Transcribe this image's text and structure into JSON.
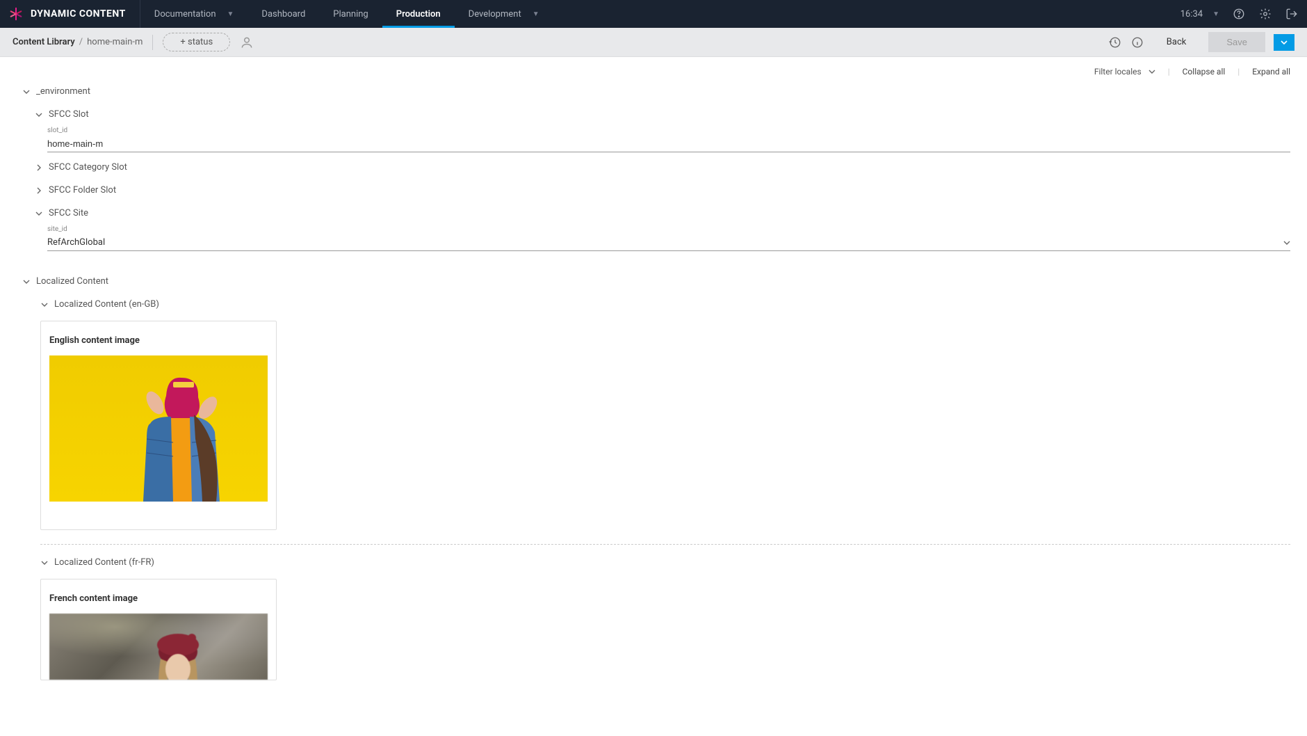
{
  "app": {
    "name": "DYNAMIC CONTENT",
    "time": "16:34"
  },
  "nav": {
    "documentation": "Documentation",
    "dashboard": "Dashboard",
    "planning": "Planning",
    "production": "Production",
    "development": "Development"
  },
  "subbar": {
    "crumb_root": "Content Library",
    "crumb_item": "home-main-m",
    "status": "+ status",
    "back": "Back",
    "save": "Save"
  },
  "toolbar": {
    "filter_locales": "Filter locales",
    "collapse_all": "Collapse all",
    "expand_all": "Expand all"
  },
  "sections": {
    "environment": {
      "label": "_environment",
      "sfcc_slot": {
        "label": "SFCC Slot",
        "slot_id_label": "slot_id",
        "slot_id_value": "home-main-m"
      },
      "sfcc_category_slot": "SFCC Category Slot",
      "sfcc_folder_slot": "SFCC Folder Slot",
      "sfcc_site": {
        "label": "SFCC Site",
        "site_id_label": "site_id",
        "site_id_value": "RefArchGlobal"
      }
    },
    "localized": {
      "label": "Localized Content",
      "en_gb": {
        "label": "Localized Content (en-GB)",
        "card_title": "English content image"
      },
      "fr_fr": {
        "label": "Localized Content (fr-FR)",
        "card_title": "French content image"
      }
    }
  }
}
